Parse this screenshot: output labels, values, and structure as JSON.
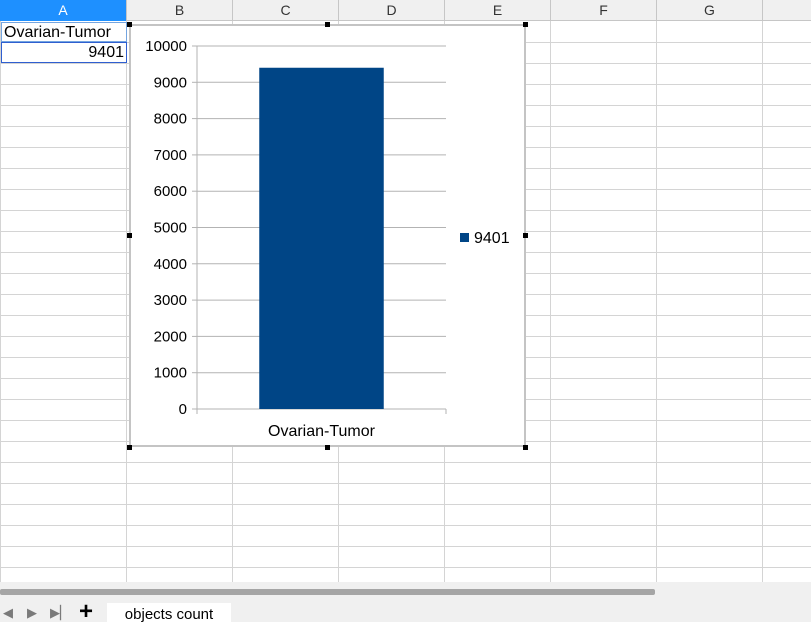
{
  "spreadsheet": {
    "columns": [
      "A",
      "B",
      "C",
      "D",
      "E",
      "F",
      "G"
    ],
    "active_column": "A",
    "cells": {
      "A1": "Ovarian-Tumor",
      "A2": "9401"
    }
  },
  "chart_data": {
    "type": "bar",
    "categories": [
      "Ovarian-Tumor"
    ],
    "series": [
      {
        "name": "9401",
        "values": [
          9401
        ],
        "color": "#004586"
      }
    ],
    "ylim": [
      0,
      10000
    ],
    "yticks": [
      0,
      1000,
      2000,
      3000,
      4000,
      5000,
      6000,
      7000,
      8000,
      9000,
      10000
    ],
    "grid": true,
    "legend": "right",
    "title": "",
    "xlabel": "",
    "ylabel": ""
  },
  "sheet_tabs": {
    "add_icon": "plus-icon",
    "tabs": [
      "objects count"
    ]
  },
  "nav_icons": [
    "first-sheet-icon",
    "prev-sheet-icon",
    "next-sheet-icon",
    "last-sheet-icon"
  ]
}
